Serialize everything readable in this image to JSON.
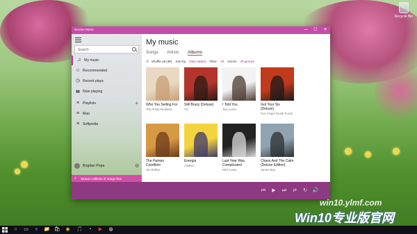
{
  "desktop": {
    "recycle_bin_label": "Recycle Bin",
    "watermark_url": "win10.ylmf.com",
    "watermark_brand": "Win10专业版官网"
  },
  "window": {
    "title": "Groove Music",
    "minimize_glyph": "—",
    "maximize_glyph": "☐",
    "close_glyph": "✕",
    "accent": "#c54ca8"
  },
  "sidebar": {
    "search_placeholder": "Search",
    "items": [
      {
        "label": "My music",
        "icon": "♫"
      },
      {
        "label": "Recommended",
        "icon": "☺"
      },
      {
        "label": "Recent plays",
        "icon": "◷"
      },
      {
        "label": "Now playing",
        "icon": "▮▮"
      },
      {
        "label": "Playlists",
        "icon": "≡"
      },
      {
        "label": "Mao",
        "icon": "≡"
      },
      {
        "label": "Softpedia",
        "icon": "≡"
      }
    ],
    "playlists_add": "+",
    "user_name": "Bogdan Popa",
    "promo_text": "Stream millions of songs free",
    "promo_icon": "♪"
  },
  "main": {
    "title": "My music",
    "tabs": [
      "Songs",
      "Artists",
      "Albums"
    ],
    "selected_tab": "Albums",
    "filters": {
      "shuffle": "Shuffle all (46)",
      "sort_label": "Sort by:",
      "sort_value": "Date added",
      "filter_label": "Filter:",
      "filter_value": "All",
      "genre_label": "Genre:",
      "genre_value": "All genres"
    },
    "albums": [
      {
        "title": "Who You Selling For",
        "artist": "The Pretty Reckless",
        "bg": "#e9d9c3",
        "fg": "#c79e74"
      },
      {
        "title": "Still Brazy (Deluxe)",
        "artist": "YG",
        "bg": "#b4352c",
        "fg": "#2b1a14"
      },
      {
        "title": "I Told You",
        "artist": "Tory Lanez",
        "bg": "#f2f2f2",
        "fg": "#4c3b32"
      },
      {
        "title": "Got Your Six (Deluxe)",
        "artist": "Five Finger Death Punch",
        "bg": "#c23a1c",
        "fg": "#1a1a1a"
      },
      {
        "title": "The Human Condition",
        "artist": "Jon Bellion",
        "bg": "#d69a45",
        "fg": "#6d3a1b"
      },
      {
        "title": "Energia",
        "artist": "J Balvin",
        "bg": "#f4d43e",
        "fg": "#3d3a6b"
      },
      {
        "title": "Last Year Was Complicated",
        "artist": "Nick Jonas",
        "bg": "#222222",
        "fg": "#d9d9d9"
      },
      {
        "title": "Chaos And The Calm (Deluxe Edition)",
        "artist": "James Bay",
        "bg": "#8fa3b0",
        "fg": "#2b2f33"
      }
    ]
  },
  "playbar": {
    "icons": [
      "⏮",
      "▶",
      "⏭",
      "⇄",
      "↻",
      "🔊"
    ]
  },
  "taskbar": {
    "icons": [
      "○",
      "▭",
      "e",
      "📁",
      "🛍",
      "◉",
      "🎵",
      "◔",
      "▶",
      "◍"
    ]
  }
}
